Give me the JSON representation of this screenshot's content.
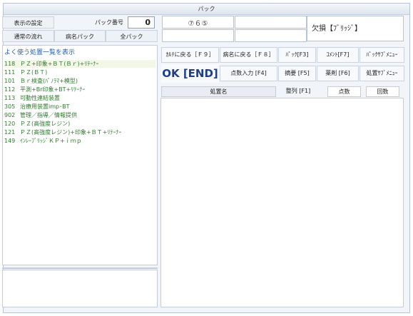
{
  "window": {
    "title": "パック"
  },
  "left_header": {
    "display_settings": "表示の設定",
    "pack_number_label": "パック番号",
    "pack_number_value": "0",
    "normal_flow": "通常の流れ",
    "disease_pack": "病名パック",
    "all_packs": "全パック"
  },
  "treatment_list": {
    "title": "よく使う処置一覧を表示",
    "items": [
      {
        "code": "118",
        "name": "ＰＺ+印象+ＢＴ(Ｂｒ)+ﾘﾃｰﾅｰ"
      },
      {
        "code": "111",
        "name": "ＰＺ(ＢＴ)"
      },
      {
        "code": "101",
        "name": "Ｂｒ検査(ﾊﾟﾉﾗﾏ+模型)"
      },
      {
        "code": "112",
        "name": "平測+Br印象+BT+ﾘﾃｰﾅｰ"
      },
      {
        "code": "113",
        "name": "可動性連結装置"
      },
      {
        "code": "305",
        "name": "治療用装置imp･BT"
      },
      {
        "code": "902",
        "name": "管理／指導／情報提供"
      },
      {
        "code": "120",
        "name": "ＰＺ(高強度レジン)"
      },
      {
        "code": "121",
        "name": "ＰＺ(高強度レジン)+印象+ＢＴ+ﾘﾃｰﾅｰ"
      },
      {
        "code": "149",
        "name": "ｲﾝﾚｰﾌﾞﾘｯｼﾞＫＰ+ｉｍｐ"
      }
    ]
  },
  "tooth_info": {
    "teeth": "⑦６⑤"
  },
  "defect_label": "欠損【ﾌﾞﾘｯｼﾞ】",
  "buttons": {
    "back_to_chart": "ｶﾙﾃに戻る［Ｆ９］",
    "back_to_disease": "病名に戻る［Ｆ８］",
    "pack": "ﾊﾟｯｸ[F3]",
    "comment": "ｺﾒﾝﾄ[F7]",
    "pack_submenu": "ﾊﾟｯｸｻﾌﾞﾒﾆｭｰ",
    "ok": "OK [END]",
    "points_input": "点数入力 [F4]",
    "summary": "摘要 [F5]",
    "medicine": "薬剤 [F6]",
    "treatment_submenu": "処置ｻﾌﾞﾒﾆｭｰ"
  },
  "table": {
    "columns": {
      "name": "処置名",
      "sort": "整列 [F1]",
      "points": "点数",
      "count": "回数"
    }
  }
}
